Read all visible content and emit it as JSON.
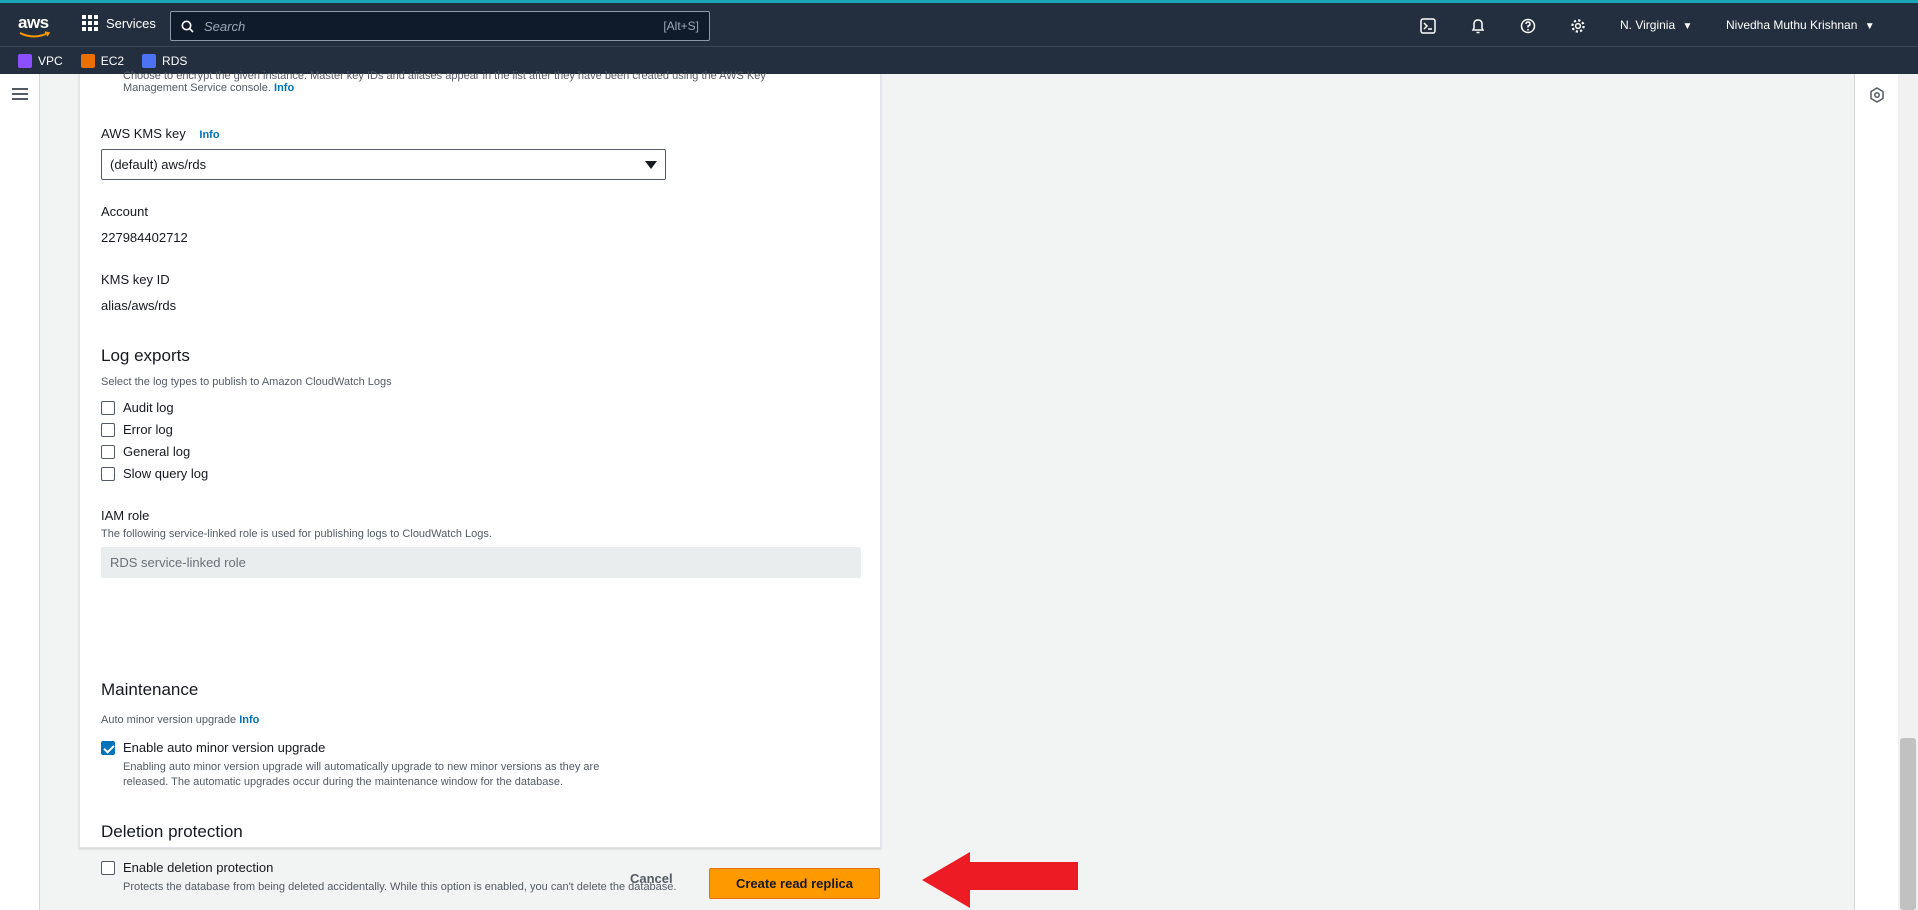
{
  "topbar": {
    "logo": "aws",
    "services_label": "Services",
    "search_placeholder": "Search",
    "search_shortcut": "[Alt+S]",
    "region": "N. Virginia",
    "user": "Nivedha Muthu Krishnan"
  },
  "favorites": [
    {
      "label": "VPC",
      "color": "#8c4fff"
    },
    {
      "label": "EC2",
      "color": "#ed7100"
    },
    {
      "label": "RDS",
      "color": "#4d72f3"
    }
  ],
  "encryption": {
    "desc_line1": "Choose to encrypt the given instance. Master key IDs and aliases appear in the list after they have been created using the AWS Key",
    "desc_line2": "Management Service console.",
    "info": "Info"
  },
  "kms": {
    "label": "AWS KMS key",
    "info": "Info",
    "selected": "(default) aws/rds",
    "account_label": "Account",
    "account_value": "227984402712",
    "key_id_label": "KMS key ID",
    "key_id_value": "alias/aws/rds"
  },
  "log_exports": {
    "heading": "Log exports",
    "desc": "Select the log types to publish to Amazon CloudWatch Logs",
    "options": [
      {
        "label": "Audit log",
        "checked": false
      },
      {
        "label": "Error log",
        "checked": false
      },
      {
        "label": "General log",
        "checked": false
      },
      {
        "label": "Slow query log",
        "checked": false
      }
    ]
  },
  "iam": {
    "label": "IAM role",
    "desc": "The following service-linked role is used for publishing logs to CloudWatch Logs.",
    "value": "RDS service-linked role"
  },
  "maintenance": {
    "heading": "Maintenance",
    "sub": "Auto minor version upgrade",
    "info": "Info",
    "option_label": "Enable auto minor version upgrade",
    "option_desc_line1": "Enabling auto minor version upgrade will automatically upgrade to new minor versions as they are",
    "option_desc_line2": "released. The automatic upgrades occur during the maintenance window for the database.",
    "checked": true
  },
  "deletion": {
    "heading": "Deletion protection",
    "option_label": "Enable deletion protection",
    "option_desc": "Protects the database from being deleted accidentally. While this option is enabled, you can't delete the database.",
    "checked": false
  },
  "actions": {
    "cancel": "Cancel",
    "primary": "Create read replica"
  },
  "colors": {
    "accent": "#ff9900",
    "link": "#0073bb",
    "nav_bg": "#232f3e",
    "annotation_arrow": "#ed1c24"
  }
}
